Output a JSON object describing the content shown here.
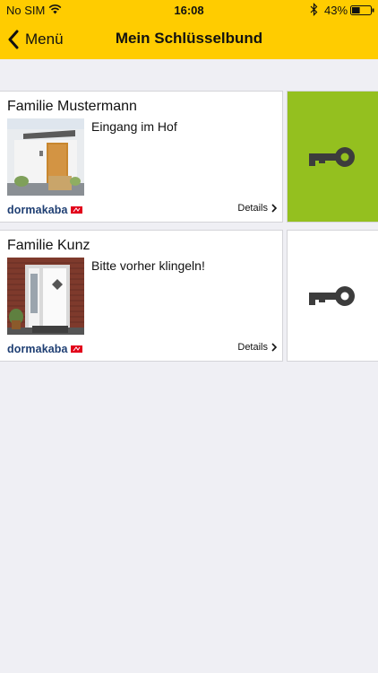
{
  "statusbar": {
    "carrier": "No SIM",
    "time": "16:08",
    "battery": "43%",
    "battery_level": 0.43
  },
  "header": {
    "back_label": "Menü",
    "title": "Mein Schlüsselbund",
    "color": "#ffcc00"
  },
  "keys": [
    {
      "name": "Familie Mustermann",
      "note": "Eingang im Hof",
      "brand": "dormakaba",
      "details_label": "Details",
      "key_active": true,
      "key_button_color": "#94c01f"
    },
    {
      "name": "Familie Kunz",
      "note": "Bitte vorher klingeln!",
      "brand": "dormakaba",
      "details_label": "Details",
      "key_active": false,
      "key_button_color": "#ffffff"
    }
  ],
  "icons": {
    "back": "chevron-left-icon",
    "key": "key-icon",
    "details": "chevron-right-icon",
    "wifi": "wifi-icon",
    "bluetooth": "bluetooth-icon",
    "battery": "battery-icon"
  }
}
